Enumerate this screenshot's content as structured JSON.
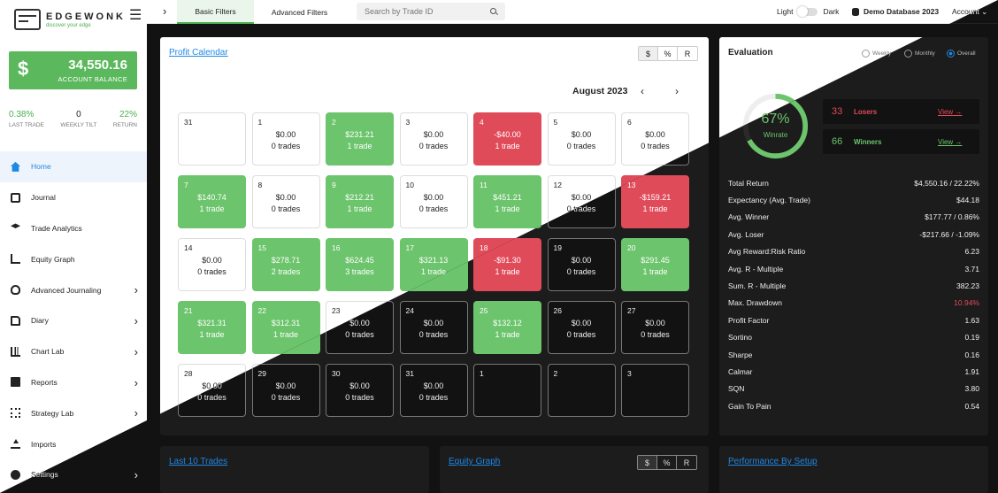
{
  "sidebar": {
    "logo_name": "EDGEWONK",
    "logo_tag": "discover your edge",
    "balance_value": "34,550.16",
    "balance_label": "ACCOUNT BALANCE",
    "balance_symbol": "$",
    "stats": [
      {
        "value": "0.38%",
        "label": "LAST TRADE"
      },
      {
        "value": "0",
        "label": "WEEKLY TILT"
      },
      {
        "value": "22%",
        "label": "RETURN"
      }
    ],
    "items": [
      {
        "label": "Home",
        "icon": "home-icon"
      },
      {
        "label": "Journal",
        "icon": "journal-icon"
      },
      {
        "label": "Trade Analytics",
        "icon": "layers-icon"
      },
      {
        "label": "Equity Graph",
        "icon": "line-graph-icon"
      },
      {
        "label": "Advanced Journaling",
        "icon": "lightbulb-icon"
      },
      {
        "label": "Diary",
        "icon": "diary-icon"
      },
      {
        "label": "Chart Lab",
        "icon": "bar-chart-icon"
      },
      {
        "label": "Reports",
        "icon": "clipboard-icon"
      },
      {
        "label": "Strategy Lab",
        "icon": "strategy-icon"
      },
      {
        "label": "Imports",
        "icon": "upload-icon"
      },
      {
        "label": "Settings",
        "icon": "gear-icon"
      }
    ]
  },
  "topbar": {
    "tab_basic": "Basic Filters",
    "tab_advanced": "Advanced Filters",
    "search_placeholder": "Search by Trade ID",
    "theme_light": "Light",
    "theme_dark": "Dark",
    "database": "Demo Database 2023",
    "account": "Account"
  },
  "calendar": {
    "title": "Profit Calendar",
    "units": [
      "$",
      "%",
      "R"
    ],
    "month": "August 2023",
    "days": [
      {
        "d": "31",
        "p": "",
        "t": "",
        "s": "w"
      },
      {
        "d": "1",
        "p": "$0.00",
        "t": "0 trades",
        "s": "w"
      },
      {
        "d": "2",
        "p": "$231.21",
        "t": "1 trade",
        "s": "g"
      },
      {
        "d": "3",
        "p": "$0.00",
        "t": "0 trades",
        "s": "w"
      },
      {
        "d": "4",
        "p": "-$40.00",
        "t": "1 trade",
        "s": "r"
      },
      {
        "d": "5",
        "p": "$0.00",
        "t": "0 trades",
        "s": "w"
      },
      {
        "d": "6",
        "p": "$0.00",
        "t": "0 trades",
        "s": "w"
      },
      {
        "d": "7",
        "p": "$140.74",
        "t": "1 trade",
        "s": "g"
      },
      {
        "d": "8",
        "p": "$0.00",
        "t": "0 trades",
        "s": "w"
      },
      {
        "d": "9",
        "p": "$212.21",
        "t": "1 trade",
        "s": "g"
      },
      {
        "d": "10",
        "p": "$0.00",
        "t": "0 trades",
        "s": "w"
      },
      {
        "d": "11",
        "p": "$451.21",
        "t": "1 trade",
        "s": "g"
      },
      {
        "d": "12",
        "p": "$0.00",
        "t": "0 trades",
        "s": "w"
      },
      {
        "d": "13",
        "p": "-$159.21",
        "t": "1 trade",
        "s": "r"
      },
      {
        "d": "14",
        "p": "$0.00",
        "t": "0 trades",
        "s": "w"
      },
      {
        "d": "15",
        "p": "$278.71",
        "t": "2 trades",
        "s": "g"
      },
      {
        "d": "16",
        "p": "$624.45",
        "t": "3 trades",
        "s": "g"
      },
      {
        "d": "17",
        "p": "$321.13",
        "t": "1 trade",
        "s": "g"
      },
      {
        "d": "18",
        "p": "-$91.30",
        "t": "1 trade",
        "s": "r"
      },
      {
        "d": "19",
        "p": "$0.00",
        "t": "0 trades",
        "s": "w"
      },
      {
        "d": "20",
        "p": "$291.45",
        "t": "1 trade",
        "s": "g"
      },
      {
        "d": "21",
        "p": "$321.31",
        "t": "1 trade",
        "s": "g"
      },
      {
        "d": "22",
        "p": "$312.31",
        "t": "1 trade",
        "s": "g"
      },
      {
        "d": "23",
        "p": "$0.00",
        "t": "0 trades",
        "s": "w"
      },
      {
        "d": "24",
        "p": "$0.00",
        "t": "0 trades",
        "s": "w"
      },
      {
        "d": "25",
        "p": "$132.12",
        "t": "1 trade",
        "s": "g"
      },
      {
        "d": "26",
        "p": "$0.00",
        "t": "0 trades",
        "s": "w"
      },
      {
        "d": "27",
        "p": "$0.00",
        "t": "0 trades",
        "s": "w"
      },
      {
        "d": "28",
        "p": "$0.00",
        "t": "0 trades",
        "s": "w"
      },
      {
        "d": "29",
        "p": "$0.00",
        "t": "0 trades",
        "s": "w"
      },
      {
        "d": "30",
        "p": "$0.00",
        "t": "0 trades",
        "s": "w"
      },
      {
        "d": "31",
        "p": "$0.00",
        "t": "0 trades",
        "s": "w"
      },
      {
        "d": "1",
        "p": "",
        "t": "",
        "s": "w"
      },
      {
        "d": "2",
        "p": "",
        "t": "",
        "s": "w"
      },
      {
        "d": "3",
        "p": "",
        "t": "",
        "s": "w"
      }
    ]
  },
  "evaluation": {
    "title": "Evaluation",
    "periods": [
      "Weekly",
      "Monthly",
      "Overall"
    ],
    "winrate_value": "67%",
    "winrate_fraction": 0.67,
    "winrate_label": "Winrate",
    "losers": {
      "count": "33",
      "label": "Losers",
      "link": "View"
    },
    "winners": {
      "count": "66",
      "label": "Winners",
      "link": "View"
    },
    "metrics": [
      {
        "label": "Total Return",
        "value": "$4,550.16 / 22.22%"
      },
      {
        "label": "Expectancy (Avg. Trade)",
        "value": "$44.18"
      },
      {
        "label": "Avg. Winner",
        "value": "$177.77 / 0.86%"
      },
      {
        "label": "Avg. Loser",
        "value": "-$217.66 / -1.09%"
      },
      {
        "label": "Avg Reward:Risk Ratio",
        "value": "6.23"
      },
      {
        "label": "Avg. R - Multiple",
        "value": "3.71"
      },
      {
        "label": "Sum. R - Multiple",
        "value": "382.23"
      },
      {
        "label": "Max. Drawdown",
        "value": "10.94%"
      },
      {
        "label": "Profit Factor",
        "value": "1.63"
      },
      {
        "label": "Sortino",
        "value": "0.19"
      },
      {
        "label": "Sharpe",
        "value": "0.16"
      },
      {
        "label": "Calmar",
        "value": "1.91"
      },
      {
        "label": "SQN",
        "value": "3.80"
      },
      {
        "label": "Gain To Pain",
        "value": "0.54"
      }
    ]
  },
  "bottom": {
    "last_trades": "Last 10 Trades",
    "equity_graph": "Equity Graph",
    "performance": "Performance By Setup",
    "units": [
      "$",
      "%",
      "R"
    ]
  },
  "colors": {
    "green": "#6cc46c",
    "red": "#e04b5a",
    "accent": "#1e88e5",
    "dark_bg": "#121212"
  }
}
